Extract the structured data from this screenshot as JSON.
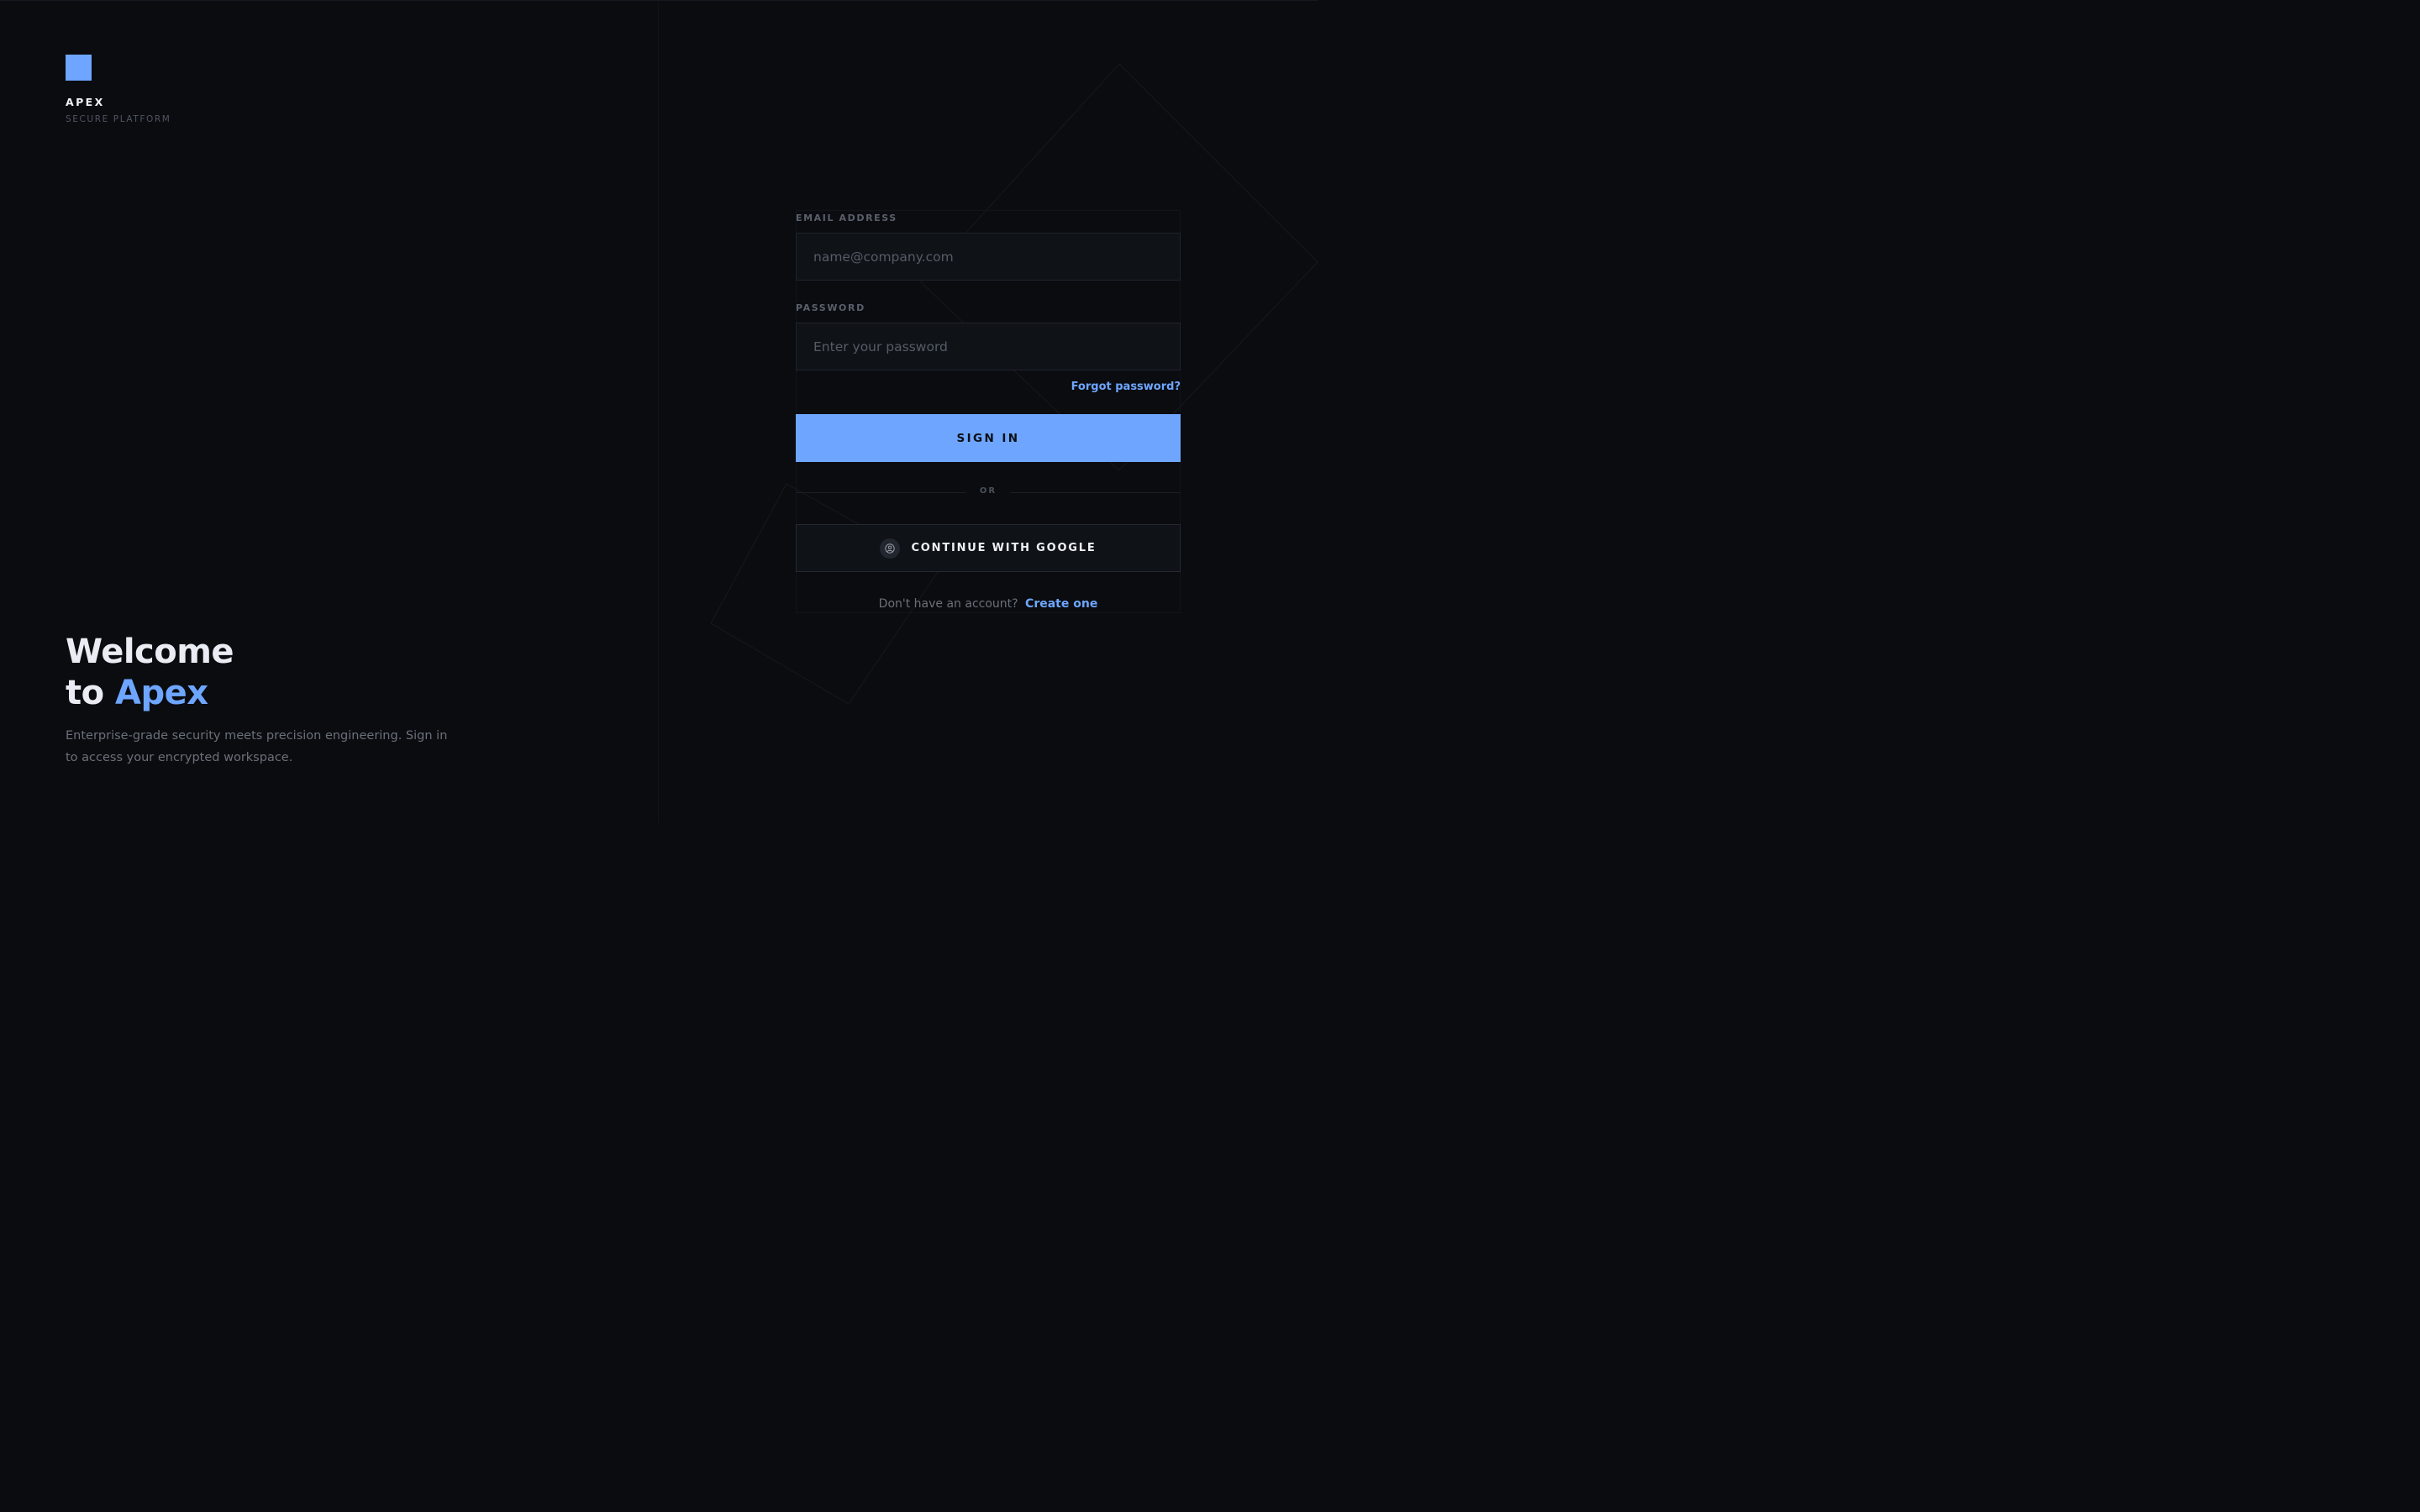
{
  "brand": {
    "name": "APEX",
    "tagline": "SECURE PLATFORM",
    "accent_color": "#6ea6ff"
  },
  "hero": {
    "line1": "Welcome",
    "line2_prefix": "to",
    "line2_accent": "Apex",
    "description": "Enterprise-grade security meets precision engineering. Sign in to access your encrypted workspace."
  },
  "form": {
    "email": {
      "label": "EMAIL ADDRESS",
      "placeholder": "name@company.com",
      "value": ""
    },
    "password": {
      "label": "PASSWORD",
      "placeholder": "Enter your password",
      "value": ""
    },
    "forgot_label": "Forgot password?",
    "submit_label": "SIGN IN",
    "divider_label": "OR",
    "google": {
      "label": "CONTINUE WITH GOOGLE",
      "icon": "user-circle-icon"
    },
    "signup": {
      "prompt": "Don't have an account?",
      "link_label": "Create one"
    }
  },
  "colors": {
    "background": "#0a0c10",
    "input_background": "#0f1217",
    "primary": "#6ea6ff",
    "muted_text": "#6b7079"
  }
}
